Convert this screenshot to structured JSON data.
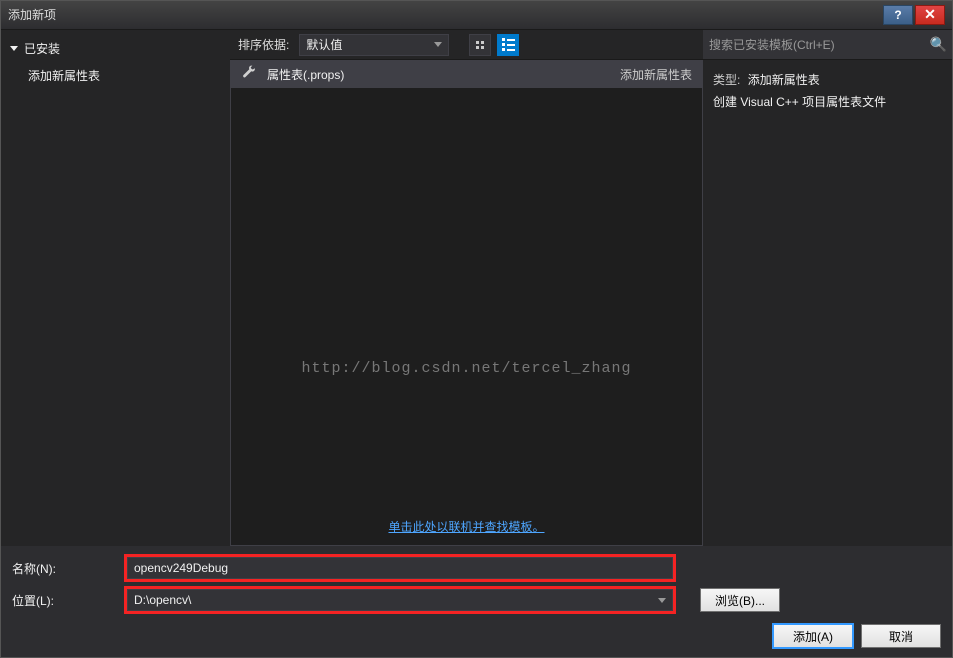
{
  "window": {
    "title": "添加新项"
  },
  "sidebar": {
    "category": "已安装",
    "items": [
      "添加新属性表"
    ]
  },
  "toolbar": {
    "sort_label": "排序依据:",
    "sort_value": "默认值"
  },
  "templates": [
    {
      "name": "属性表(.props)",
      "tag": "添加新属性表"
    }
  ],
  "watermark": "http://blog.csdn.net/tercel_zhang",
  "online_link": "单击此处以联机并查找模板。",
  "search": {
    "placeholder": "搜索已安装模板(Ctrl+E)"
  },
  "info": {
    "type_label": "类型:",
    "type_value": "添加新属性表",
    "desc": "创建 Visual C++ 项目属性表文件"
  },
  "form": {
    "name_label": "名称(N):",
    "name_value": "opencv249Debug",
    "loc_label": "位置(L):",
    "loc_value": "D:\\opencv\\",
    "browse": "浏览(B)..."
  },
  "buttons": {
    "add": "添加(A)",
    "cancel": "取消"
  }
}
